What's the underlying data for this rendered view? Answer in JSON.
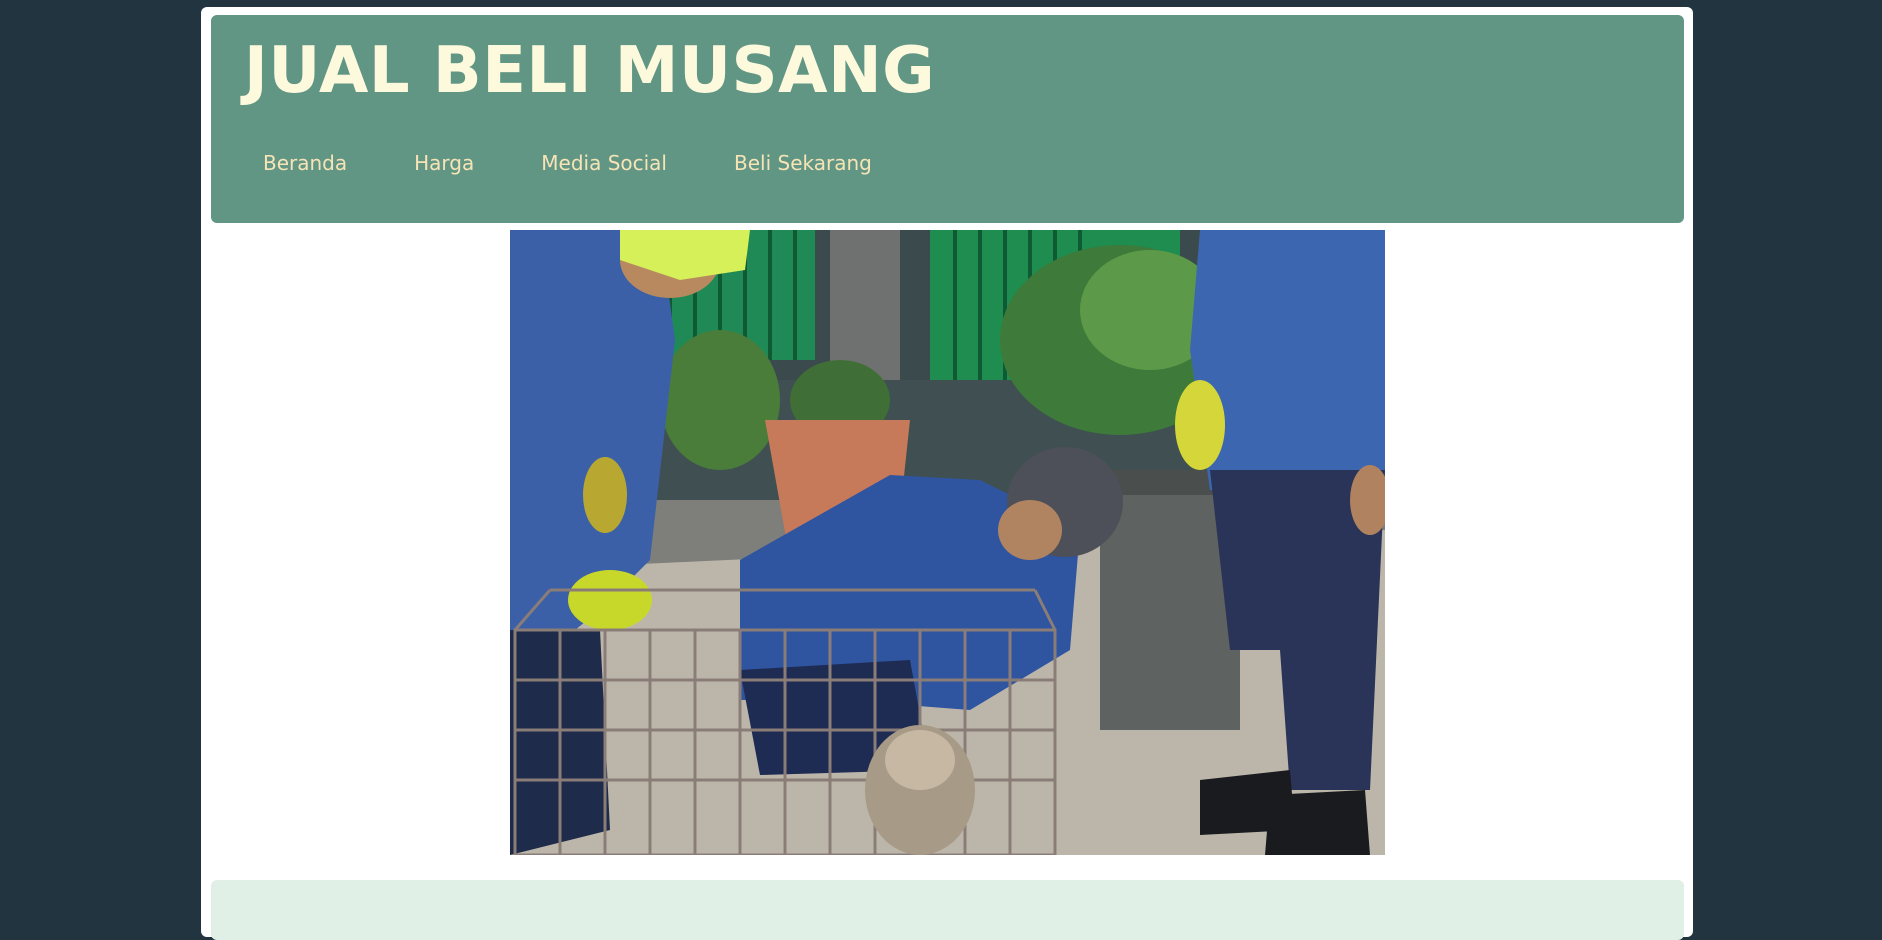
{
  "site": {
    "title": "JUAL BELI MUSANG"
  },
  "nav": {
    "items": [
      {
        "label": "Beranda"
      },
      {
        "label": "Harga"
      },
      {
        "label": "Media Social"
      },
      {
        "label": "Beli Sekarang"
      }
    ]
  },
  "colors": {
    "background": "#233441",
    "header": "#619685",
    "title": "#fdf9dc",
    "nav_link": "#f7e4b6",
    "content_box": "#e1f0e6"
  }
}
